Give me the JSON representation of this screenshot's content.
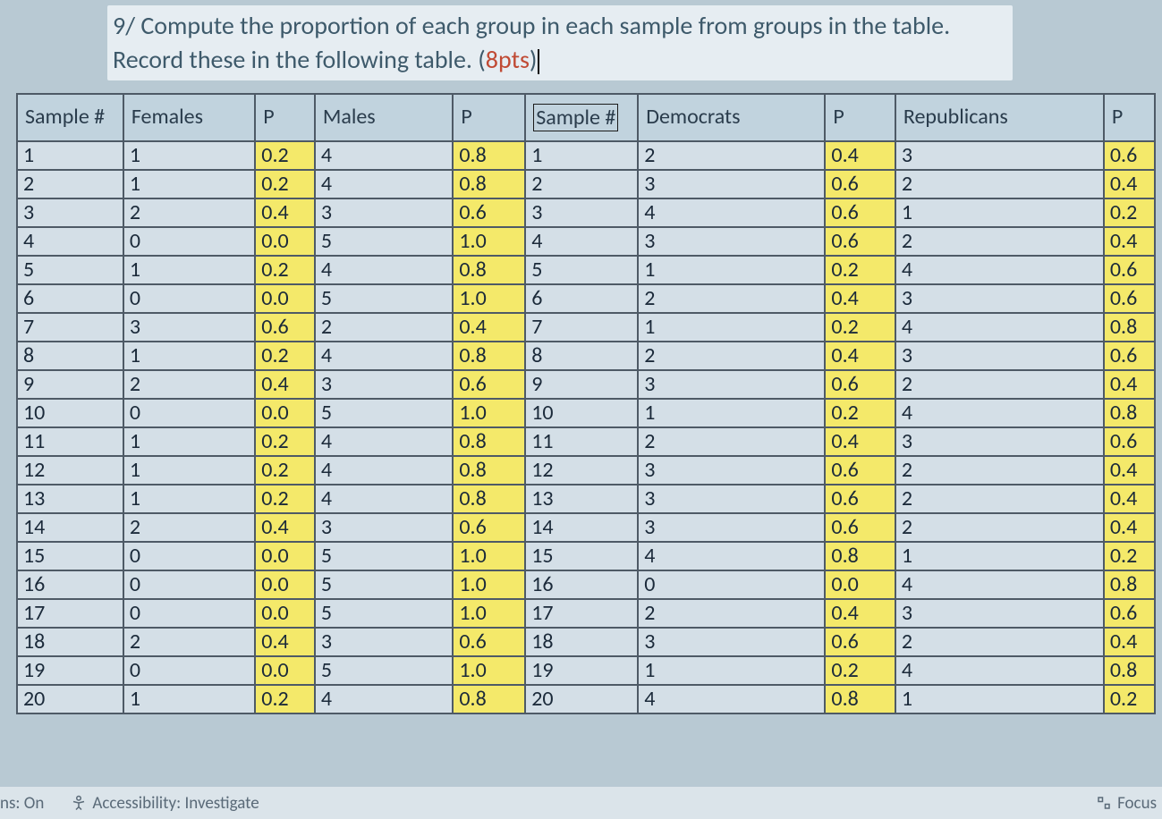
{
  "question": {
    "prefix": "9/ Compute the proportion of each group in each sample from groups in the table. Record these in the following table. (",
    "pts": "8pts",
    "suffix": ")"
  },
  "headers": {
    "sample1": "Sample #",
    "females": "Females",
    "p1": "P",
    "males": "Males",
    "p2": "P",
    "sample2": "Sample #",
    "democrats": "Democrats",
    "p3": "P",
    "republicans": "Republicans",
    "p4": "P"
  },
  "rows": [
    {
      "s1": "1",
      "fem": "1",
      "p1": "0.2",
      "mal": "4",
      "p2": "0.8",
      "s2": "1",
      "dem": "2",
      "p3": "0.4",
      "rep": "3",
      "p4": "0.6"
    },
    {
      "s1": "2",
      "fem": "1",
      "p1": "0.2",
      "mal": "4",
      "p2": "0.8",
      "s2": "2",
      "dem": "3",
      "p3": "0.6",
      "rep": "2",
      "p4": "0.4"
    },
    {
      "s1": "3",
      "fem": "2",
      "p1": "0.4",
      "mal": "3",
      "p2": "0.6",
      "s2": "3",
      "dem": "4",
      "p3": "0.6",
      "rep": "1",
      "p4": "0.2"
    },
    {
      "s1": "4",
      "fem": "0",
      "p1": "0.0",
      "mal": "5",
      "p2": "1.0",
      "s2": "4",
      "dem": "3",
      "p3": "0.6",
      "rep": "2",
      "p4": "0.4"
    },
    {
      "s1": "5",
      "fem": "1",
      "p1": "0.2",
      "mal": "4",
      "p2": "0.8",
      "s2": "5",
      "dem": "1",
      "p3": "0.2",
      "rep": "4",
      "p4": "0.6"
    },
    {
      "s1": "6",
      "fem": "0",
      "p1": "0.0",
      "mal": "5",
      "p2": "1.0",
      "s2": "6",
      "dem": "2",
      "p3": "0.4",
      "rep": "3",
      "p4": "0.6"
    },
    {
      "s1": "7",
      "fem": "3",
      "p1": "0.6",
      "mal": "2",
      "p2": "0.4",
      "s2": "7",
      "dem": "1",
      "p3": "0.2",
      "rep": "4",
      "p4": "0.8"
    },
    {
      "s1": "8",
      "fem": "1",
      "p1": "0.2",
      "mal": "4",
      "p2": "0.8",
      "s2": "8",
      "dem": "2",
      "p3": "0.4",
      "rep": "3",
      "p4": "0.6"
    },
    {
      "s1": "9",
      "fem": "2",
      "p1": "0.4",
      "mal": "3",
      "p2": "0.6",
      "s2": "9",
      "dem": "3",
      "p3": "0.6",
      "rep": "2",
      "p4": "0.4"
    },
    {
      "s1": "10",
      "fem": "0",
      "p1": "0.0",
      "mal": "5",
      "p2": "1.0",
      "s2": "10",
      "dem": "1",
      "p3": "0.2",
      "rep": "4",
      "p4": "0.8"
    },
    {
      "s1": "11",
      "fem": "1",
      "p1": "0.2",
      "mal": "4",
      "p2": "0.8",
      "s2": "11",
      "dem": "2",
      "p3": "0.4",
      "rep": "3",
      "p4": "0.6"
    },
    {
      "s1": "12",
      "fem": "1",
      "p1": "0.2",
      "mal": "4",
      "p2": "0.8",
      "s2": "12",
      "dem": "3",
      "p3": "0.6",
      "rep": "2",
      "p4": "0.4"
    },
    {
      "s1": "13",
      "fem": "1",
      "p1": "0.2",
      "mal": "4",
      "p2": "0.8",
      "s2": "13",
      "dem": "3",
      "p3": "0.6",
      "rep": "2",
      "p4": "0.4"
    },
    {
      "s1": "14",
      "fem": "2",
      "p1": "0.4",
      "mal": "3",
      "p2": "0.6",
      "s2": "14",
      "dem": "3",
      "p3": "0.6",
      "rep": "2",
      "p4": "0.4"
    },
    {
      "s1": "15",
      "fem": "0",
      "p1": "0.0",
      "mal": "5",
      "p2": "1.0",
      "s2": "15",
      "dem": "4",
      "p3": "0.8",
      "rep": "1",
      "p4": "0.2"
    },
    {
      "s1": "16",
      "fem": "0",
      "p1": "0.0",
      "mal": "5",
      "p2": "1.0",
      "s2": "16",
      "dem": "0",
      "p3": "0.0",
      "rep": "4",
      "p4": "0.8"
    },
    {
      "s1": "17",
      "fem": "0",
      "p1": "0.0",
      "mal": "5",
      "p2": "1.0",
      "s2": "17",
      "dem": "2",
      "p3": "0.4",
      "rep": "3",
      "p4": "0.6"
    },
    {
      "s1": "18",
      "fem": "2",
      "p1": "0.4",
      "mal": "3",
      "p2": "0.6",
      "s2": "18",
      "dem": "3",
      "p3": "0.6",
      "rep": "2",
      "p4": "0.4"
    },
    {
      "s1": "19",
      "fem": "0",
      "p1": "0.0",
      "mal": "5",
      "p2": "1.0",
      "s2": "19",
      "dem": "1",
      "p3": "0.2",
      "rep": "4",
      "p4": "0.8"
    },
    {
      "s1": "20",
      "fem": "1",
      "p1": "0.2",
      "mal": "4",
      "p2": "0.8",
      "s2": "20",
      "dem": "4",
      "p3": "0.8",
      "rep": "1",
      "p4": "0.2"
    }
  ],
  "status": {
    "left": "ns: On",
    "accessibility": "Accessibility: Investigate",
    "focus": "Focus"
  }
}
